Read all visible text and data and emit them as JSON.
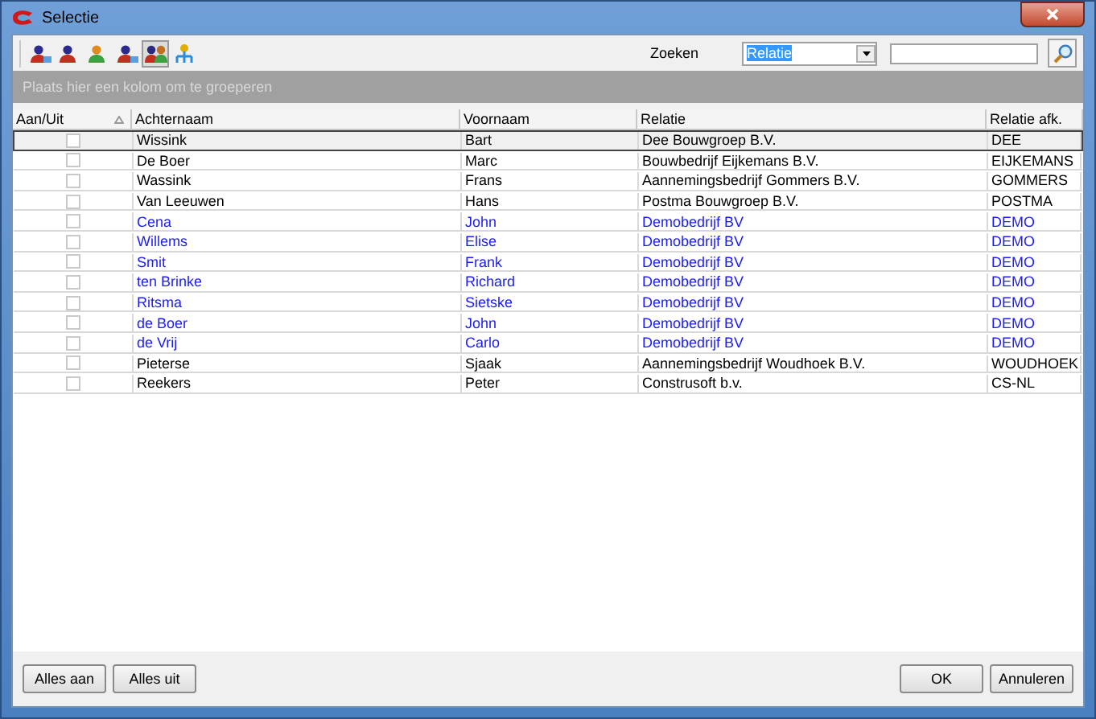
{
  "window": {
    "title": "Selectie"
  },
  "toolbar": [
    {
      "selected": false
    },
    {
      "selected": false
    },
    {
      "selected": false
    },
    {
      "selected": false
    },
    {
      "selected": true
    },
    {
      "selected": false
    }
  ],
  "search": {
    "label": "Zoeken",
    "field": "Relatie"
  },
  "group_panel": {
    "hint": "Plaats hier een kolom om te groeperen"
  },
  "table": {
    "columns": [
      "Aan/Uit",
      "Achternaam",
      "Voornaam",
      "Relatie",
      "Relatie afk."
    ],
    "rows": [
      {
        "checked": false,
        "selected": true,
        "color": "#000000",
        "cells": [
          "",
          "Wissink",
          "Bart",
          "Dee Bouwgroep B.V.",
          "DEE"
        ]
      },
      {
        "checked": false,
        "selected": false,
        "color": "#000000",
        "cells": [
          "",
          "De Boer",
          "Marc",
          "Bouwbedrijf Eijkemans B.V.",
          "EIJKEMANS"
        ]
      },
      {
        "checked": false,
        "selected": false,
        "color": "#000000",
        "cells": [
          "",
          "Wassink",
          "Frans",
          "Aannemingsbedrijf Gommers B.V.",
          "GOMMERS"
        ]
      },
      {
        "checked": false,
        "selected": false,
        "color": "#000000",
        "cells": [
          "",
          "Van Leeuwen",
          "Hans",
          "Postma Bouwgroep B.V.",
          "POSTMA"
        ]
      },
      {
        "checked": false,
        "selected": false,
        "color": "#1a1aff",
        "cells": [
          "",
          "Cena",
          "John",
          "Demobedrijf BV",
          "DEMO"
        ]
      },
      {
        "checked": false,
        "selected": false,
        "color": "#1a1aff",
        "cells": [
          "",
          "Willems",
          "Elise",
          "Demobedrijf BV",
          "DEMO"
        ]
      },
      {
        "checked": false,
        "selected": false,
        "color": "#1a1aff",
        "cells": [
          "",
          "Smit",
          "Frank",
          "Demobedrijf BV",
          "DEMO"
        ]
      },
      {
        "checked": false,
        "selected": false,
        "color": "#1a1aff",
        "cells": [
          "",
          "ten Brinke",
          "Richard",
          "Demobedrijf BV",
          "DEMO"
        ]
      },
      {
        "checked": false,
        "selected": false,
        "color": "#1a1aff",
        "cells": [
          "",
          "Ritsma",
          "Sietske",
          "Demobedrijf BV",
          "DEMO"
        ]
      },
      {
        "checked": false,
        "selected": false,
        "color": "#1a1aff",
        "cells": [
          "",
          "de Boer",
          "John",
          "Demobedrijf BV",
          "DEMO"
        ]
      },
      {
        "checked": false,
        "selected": false,
        "color": "#1a1aff",
        "cells": [
          "",
          "de Vrij",
          "Carlo",
          "Demobedrijf BV",
          "DEMO"
        ]
      },
      {
        "checked": false,
        "selected": false,
        "color": "#000000",
        "cells": [
          "",
          "Pieterse",
          "Sjaak",
          "Aannemingsbedrijf Woudhoek B.V.",
          "WOUDHOEK"
        ]
      },
      {
        "checked": false,
        "selected": false,
        "color": "#000000",
        "cells": [
          "",
          "Reekers",
          "Peter",
          "Construsoft b.v.",
          "CS-NL"
        ]
      }
    ]
  },
  "buttons_left": [
    "Alles aan",
    "Alles uit"
  ],
  "buttons_right": [
    "OK",
    "Annuleren"
  ]
}
